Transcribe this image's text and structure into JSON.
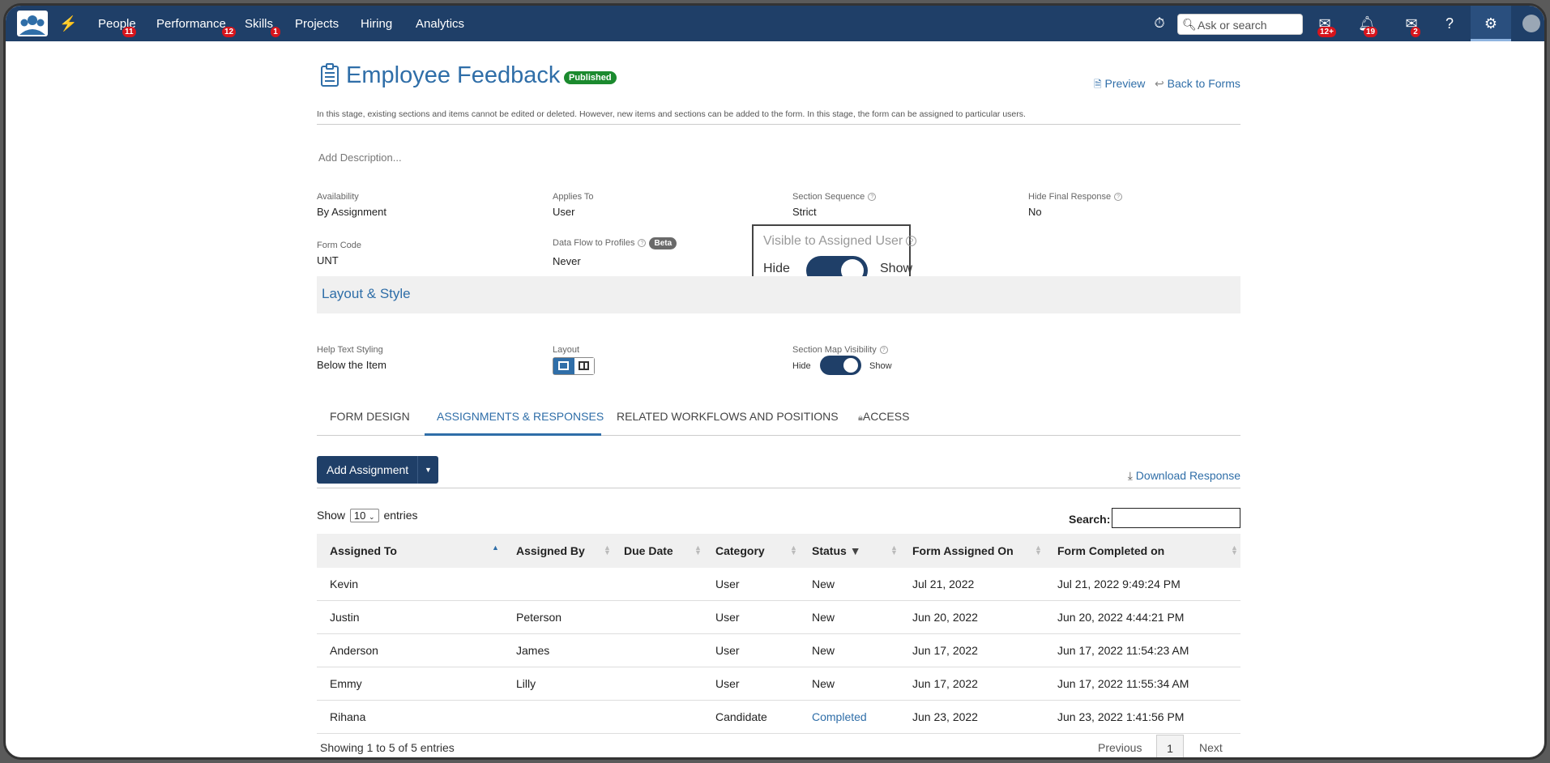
{
  "nav": {
    "items": [
      {
        "label": "People",
        "badge": "11"
      },
      {
        "label": "Performance",
        "badge": "12"
      },
      {
        "label": "Skills",
        "badge": "1"
      },
      {
        "label": "Projects",
        "badge": ""
      },
      {
        "label": "Hiring",
        "badge": ""
      },
      {
        "label": "Analytics",
        "badge": ""
      }
    ],
    "search_placeholder": "Ask or search",
    "badges": {
      "inbox": "12+",
      "notifications": "19",
      "messages": "2"
    }
  },
  "header": {
    "title": "Employee Feedback",
    "status": "Published",
    "preview_label": "Preview",
    "back_label": "Back to Forms",
    "stage_note": "In this stage, existing sections and items cannot be edited or deleted. However, new items and sections can be added to the form. In this stage, the form can be assigned to particular users.",
    "add_description": "Add Description..."
  },
  "fields": {
    "availability": {
      "label": "Availability",
      "value": "By Assignment"
    },
    "applies_to": {
      "label": "Applies To",
      "value": "User"
    },
    "section_sequence": {
      "label": "Section Sequence",
      "value": "Strict"
    },
    "hide_final_response": {
      "label": "Hide Final Response",
      "value": "No"
    },
    "form_code": {
      "label": "Form Code",
      "value": "UNT"
    },
    "data_flow": {
      "label": "Data Flow to Profiles",
      "value": "Never",
      "tag": "Beta"
    },
    "visible_to_assigned": {
      "label": "Visible to Assigned User",
      "off": "Hide",
      "on": "Show"
    }
  },
  "layout_style": {
    "title": "Layout & Style",
    "help_text": {
      "label": "Help Text Styling",
      "value": "Below the Item"
    },
    "layout": {
      "label": "Layout"
    },
    "section_map": {
      "label": "Section Map Visibility",
      "off": "Hide",
      "on": "Show"
    }
  },
  "tabs": [
    {
      "label": "FORM DESIGN"
    },
    {
      "label": "ASSIGNMENTS & RESPONSES"
    },
    {
      "label": "RELATED WORKFLOWS AND POSITIONS"
    },
    {
      "label": "ACCESS"
    }
  ],
  "assignments": {
    "add_label": "Add Assignment",
    "download_label": "Download Response",
    "show_label": "Show",
    "entries_value": "10",
    "entries_label": "entries",
    "search_label": "Search:",
    "columns": [
      "Assigned To",
      "Assigned By",
      "Due Date",
      "Category",
      "Status",
      "Form Assigned On",
      "Form Completed on"
    ],
    "rows": [
      {
        "to": "Kevin",
        "by": "",
        "due": "",
        "category": "User",
        "status": "New",
        "assigned": "Jul 21, 2022",
        "completed": "Jul 21, 2022 9:49:24 PM"
      },
      {
        "to": "Justin",
        "by": "Peterson",
        "due": "",
        "category": "User",
        "status": "New",
        "assigned": "Jun 20, 2022",
        "completed": "Jun 20, 2022 4:44:21 PM"
      },
      {
        "to": "Anderson",
        "by": "James",
        "due": "",
        "category": "User",
        "status": "New",
        "assigned": "Jun 17, 2022",
        "completed": "Jun 17, 2022 11:54:23 AM"
      },
      {
        "to": "Emmy",
        "by": "Lilly",
        "due": "",
        "category": "User",
        "status": "New",
        "assigned": "Jun 17, 2022",
        "completed": "Jun 17, 2022 11:55:34 AM"
      },
      {
        "to": "Rihana",
        "by": "",
        "due": "",
        "category": "Candidate",
        "status": "Completed",
        "assigned": "Jun 23, 2022",
        "completed": "Jun 23, 2022 1:41:56 PM"
      }
    ],
    "showing": "Showing 1 to 5 of 5 entries",
    "prev_label": "Previous",
    "current_page": "1",
    "next_label": "Next"
  },
  "colors": {
    "nav_bg": "#1f3f68",
    "accent": "#2f6ea8",
    "published": "#1b8a2e",
    "badge": "#d7141c"
  }
}
